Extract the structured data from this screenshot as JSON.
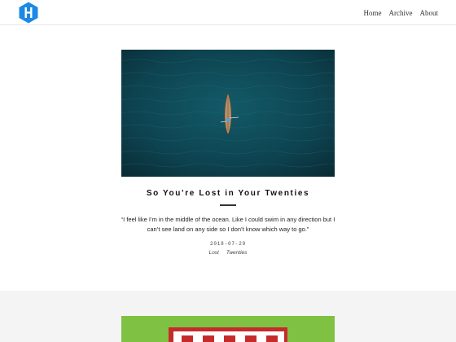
{
  "header": {
    "logo_icon": "hexo-hexagon-logo-icon",
    "nav": [
      "Home",
      "Archive",
      "About"
    ]
  },
  "post": {
    "image_icon": "aerial-kayak-ocean-photo",
    "title": "So You’re Lost in Your Twenties",
    "excerpt": "“I feel like I’m in the middle of the ocean. Like I could swim in any direction but I can’t see land on any side so I don’t know which way to go.”",
    "date": "2018-07-29",
    "tags": [
      "Lost",
      "Twenties"
    ]
  },
  "next_post": {
    "image_icon": "green-red-building-photo"
  },
  "colors": {
    "logo": "#1e88e5",
    "ocean": "#0f3f4c",
    "next_green": "#7fc142",
    "next_red": "#c62b2b",
    "section_bg": "#f4f4f4"
  }
}
